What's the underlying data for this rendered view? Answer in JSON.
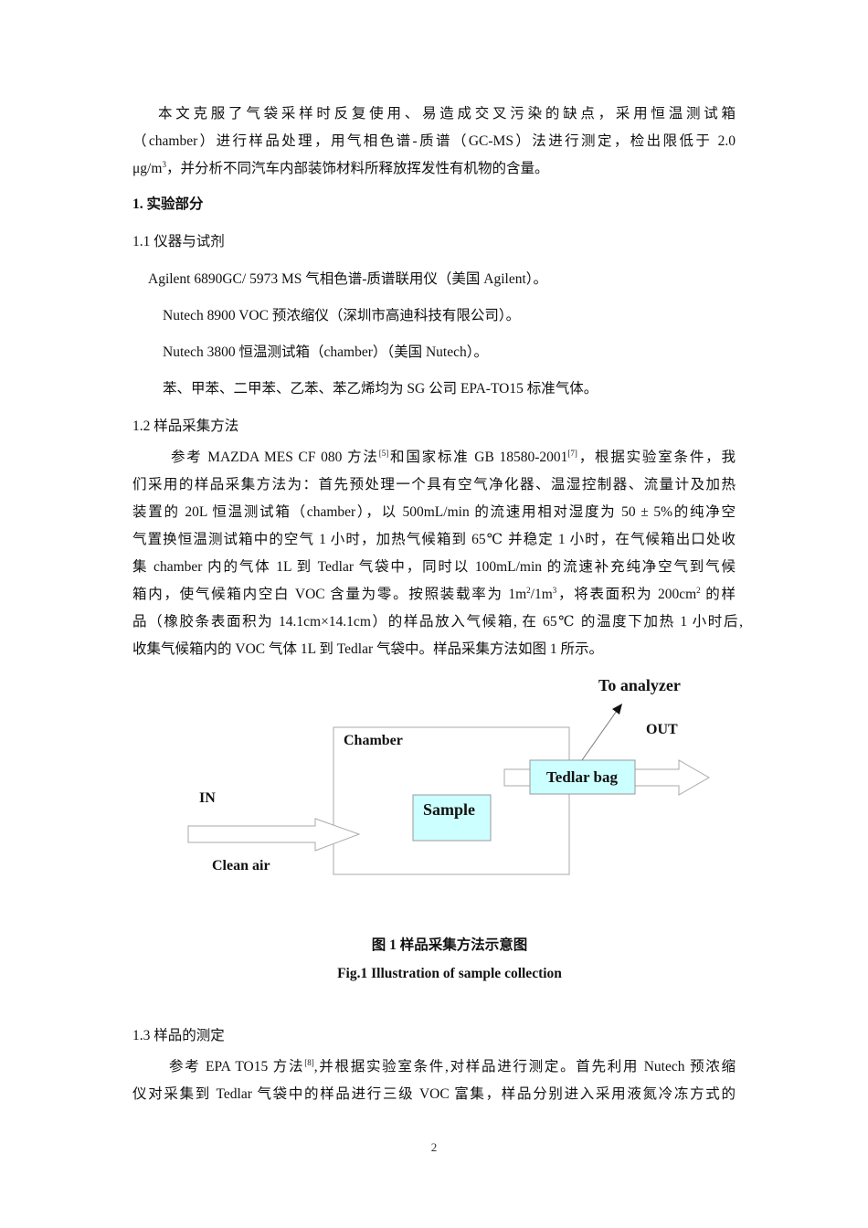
{
  "intro": {
    "line1": "本文克服了气袋采样时反复使用、易造成交叉污染的缺点，采用恒温测试箱",
    "line2": "（chamber）进行样品处理，用气相色谱-质谱（GC-MS）法进行测定，检出限低于 2.0",
    "line3_pre": "μg/m",
    "line3_sup": "3",
    "line3_post": "，并分析不同汽车内部装饰材料所释放挥发性有机物的含量。"
  },
  "section1": {
    "heading": "1. 实验部分",
    "sub1_heading": "1.1 仪器与试剂",
    "instruments": [
      "Agilent 6890GC/ 5973 MS 气相色谱-质谱联用仪（美国 Agilent）。",
      "Nutech 8900 VOC 预浓缩仪（深圳市高迪科技有限公司）。",
      "Nutech 3800 恒温测试箱（chamber）（美国 Nutech）。",
      "苯、甲苯、二甲苯、乙苯、苯乙烯均为 SG 公司 EPA-TO15 标准气体。"
    ],
    "sub2_heading": "1.2 样品采集方法",
    "sub2_para": {
      "l1_a": "参考 MAZDA MES CF 080 方法",
      "l1_ref1": "[5]",
      "l1_b": "和国家标准 GB 18580-2001",
      "l1_ref2": "[7]",
      "l1_c": "，根据实验室条件，我",
      "l2": "们采用的样品采集方法为：首先预处理一个具有空气净化器、温湿控制器、流量计及加热",
      "l3": "装置的 20L 恒温测试箱（chamber），以 500mL/min 的流速用相对湿度为 50 ± 5%的纯净空",
      "l4": "气置换恒温测试箱中的空气 1 小时，加热气候箱到 65℃ 并稳定 1 小时，在气候箱出口处收",
      "l5": "集 chamber 内的气体 1L 到 Tedlar 气袋中，同时以 100mL/min 的流速补充纯净空气到气候",
      "l6_a": "箱内，使气候箱内空白 VOC 含量为零。按照装载率为 1m",
      "l6_sup1": "2",
      "l6_b": "/1m",
      "l6_sup2": "3",
      "l6_c": "，将表面积为 200cm",
      "l6_sup3": "2",
      "l6_d": " 的样",
      "l7": "品（橡胶条表面积为 14.1cm×14.1cm）的样品放入气候箱, 在 65℃ 的温度下加热 1 小时后,",
      "l8": "收集气候箱内的 VOC 气体 1L 到 Tedlar 气袋中。样品采集方法如图 1 所示。"
    },
    "sub3_heading": "1.3 样品的测定",
    "sub3_para": {
      "l1_a": "参考 EPA TO15 方法",
      "l1_ref": "[8]",
      "l1_b": ",并根据实验室条件,对样品进行测定。首先利用 Nutech 预浓缩",
      "l2": "仪对采集到 Tedlar 气袋中的样品进行三级 VOC 富集，样品分别进入采用液氮冷冻方式的"
    }
  },
  "figure": {
    "labels": {
      "to_analyzer": "To analyzer",
      "out": "OUT",
      "chamber": "Chamber",
      "tedlar_bag": "Tedlar bag",
      "in": "IN",
      "sample": "Sample",
      "clean_air": "Clean air"
    },
    "colors": {
      "box_fill": "#ccffff",
      "outline": "#aaaaaa"
    },
    "caption_cn": "图 1 样品采集方法示意图",
    "caption_en": "Fig.1 Illustration of sample collection"
  },
  "page_number": "2"
}
